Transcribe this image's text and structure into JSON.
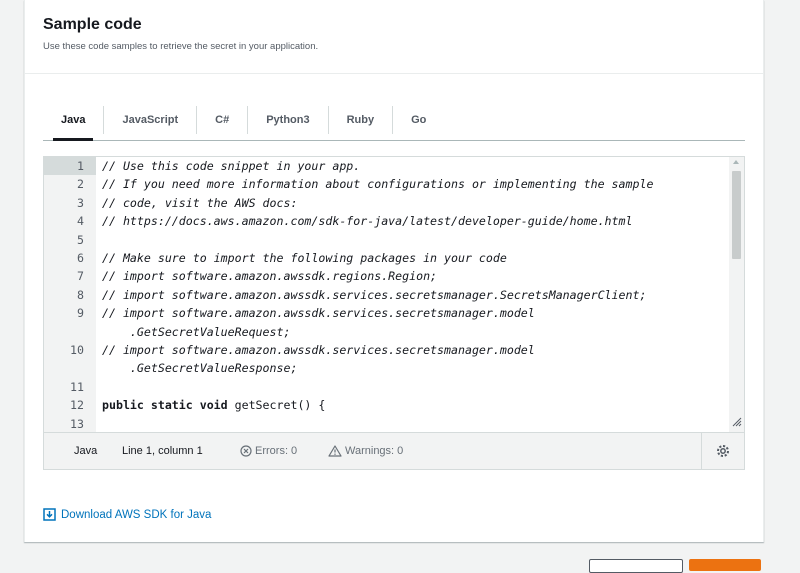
{
  "header": {
    "title": "Sample code",
    "subtitle": "Use these code samples to retrieve the secret in your application."
  },
  "tabs": [
    {
      "label": "Java",
      "active": true
    },
    {
      "label": "JavaScript",
      "active": false
    },
    {
      "label": "C#",
      "active": false
    },
    {
      "label": "Python3",
      "active": false
    },
    {
      "label": "Ruby",
      "active": false
    },
    {
      "label": "Go",
      "active": false
    }
  ],
  "editor": {
    "lines": [
      {
        "num": "1",
        "text": "// Use this code snippet in your app.",
        "style": "comment"
      },
      {
        "num": "2",
        "text": "// If you need more information about configurations or implementing the sample",
        "style": "comment"
      },
      {
        "num": "3",
        "text": "// code, visit the AWS docs:",
        "style": "comment"
      },
      {
        "num": "4",
        "text": "// https://docs.aws.amazon.com/sdk-for-java/latest/developer-guide/home.html",
        "style": "comment"
      },
      {
        "num": "5",
        "text": "",
        "style": "plain"
      },
      {
        "num": "6",
        "text": "// Make sure to import the following packages in your code",
        "style": "comment"
      },
      {
        "num": "7",
        "text": "// import software.amazon.awssdk.regions.Region;",
        "style": "comment"
      },
      {
        "num": "8",
        "text": "// import software.amazon.awssdk.services.secretsmanager.SecretsManagerClient;",
        "style": "comment"
      },
      {
        "num": "9",
        "text": "// import software.amazon.awssdk.services.secretsmanager.model\n    .GetSecretValueRequest;",
        "style": "comment"
      },
      {
        "num": "10",
        "text": "// import software.amazon.awssdk.services.secretsmanager.model\n    .GetSecretValueResponse;",
        "style": "comment"
      },
      {
        "num": "11",
        "text": "",
        "style": "plain"
      },
      {
        "num": "12",
        "keyword": "public static void",
        "text": " getSecret() {",
        "style": "code"
      },
      {
        "num": "13",
        "text": "",
        "style": "plain"
      }
    ],
    "status": {
      "language": "Java",
      "position": "Line 1, column 1",
      "errors": "Errors: 0",
      "warnings": "Warnings: 0"
    }
  },
  "download_link": "Download AWS SDK for Java",
  "colors": {
    "link": "#0073bb",
    "primary_button": "#ec7211"
  }
}
